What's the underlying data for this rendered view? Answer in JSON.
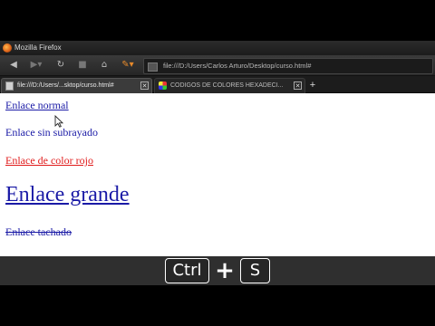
{
  "window": {
    "title": "Mozilla Firefox"
  },
  "toolbar": {
    "back_icon": "back-arrow",
    "forward_icon": "forward-arrow",
    "reload_icon": "reload",
    "stop_icon": "stop",
    "home_icon": "home",
    "addon_icon": "pencil",
    "url": "file:///D:/Users/Carlos Arturo/Desktop/curso.html#"
  },
  "tabs": [
    {
      "label": "file:///D:/Users/...sktop/curso.html#",
      "active": true
    },
    {
      "label": "CODIGOS DE COLORES HEXADECI...",
      "active": false
    }
  ],
  "page": {
    "links": [
      {
        "text": "Enlace normal"
      },
      {
        "text": "Enlace sin subrayado"
      },
      {
        "text": "Enlace de color rojo",
        "color": "#e01b1b"
      },
      {
        "text": "Enlace grande"
      },
      {
        "text": "Enlace tachado"
      }
    ],
    "link_color": "#1a1aa6"
  },
  "shortcut": {
    "key1": "Ctrl",
    "plus": "+",
    "key2": "S"
  }
}
